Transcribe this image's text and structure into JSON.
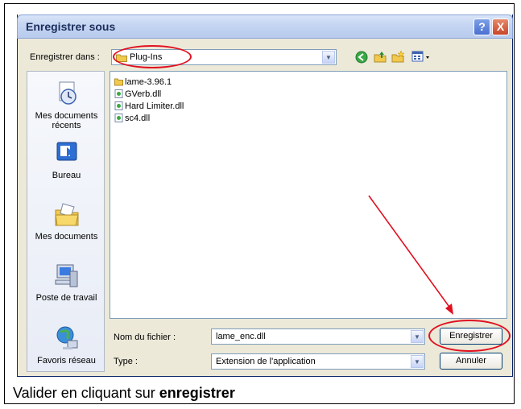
{
  "window": {
    "title": "Enregistrer sous",
    "help_symbol": "?",
    "close_symbol": "X"
  },
  "save_in": {
    "label": "Enregistrer dans :",
    "value": "Plug-Ins"
  },
  "places": [
    {
      "label": "Mes documents récents",
      "icon": "recent-documents-icon"
    },
    {
      "label": "Bureau",
      "icon": "desktop-icon"
    },
    {
      "label": "Mes documents",
      "icon": "my-documents-icon"
    },
    {
      "label": "Poste de travail",
      "icon": "my-computer-icon"
    },
    {
      "label": "Favoris réseau",
      "icon": "network-places-icon"
    }
  ],
  "files": [
    {
      "name": "lame-3.96.1",
      "type": "folder"
    },
    {
      "name": "GVerb.dll",
      "type": "dll"
    },
    {
      "name": "Hard Limiter.dll",
      "type": "dll"
    },
    {
      "name": "sc4.dll",
      "type": "dll"
    }
  ],
  "filename": {
    "label": "Nom du fichier :",
    "value": "lame_enc.dll"
  },
  "filetype": {
    "label": "Type :",
    "value": "Extension de l'application"
  },
  "buttons": {
    "save": "Enregistrer",
    "cancel": "Annuler"
  },
  "caption": {
    "prefix": "Valider en cliquant sur ",
    "bold": "enregistrer"
  },
  "colors": {
    "annotation_red": "#e01020",
    "folder_yellow": "#f2c94c"
  }
}
